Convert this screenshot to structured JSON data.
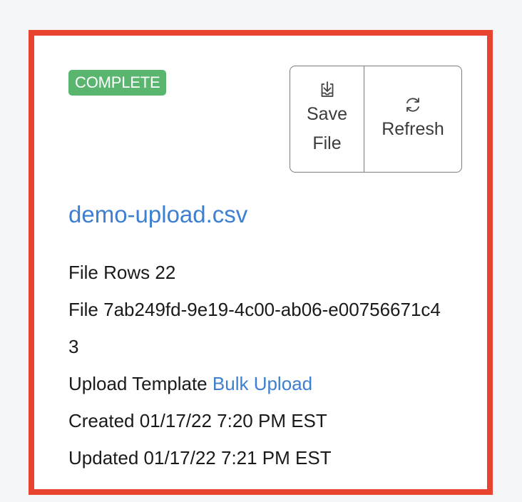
{
  "status": {
    "label": "COMPLETE",
    "color": "#5ab56e"
  },
  "actions": {
    "save_label": "Save File",
    "save_icon": "download-tray-icon",
    "refresh_label": "Refresh",
    "refresh_icon": "refresh-icon"
  },
  "file": {
    "name": "demo-upload.csv",
    "rows_label": "File Rows",
    "rows_value": "22",
    "id_label": "File",
    "id_value": "7ab249fd-9e19-4c00-ab06-e00756671c43",
    "template_label": "Upload Template",
    "template_value": "Bulk Upload",
    "created_label": "Created",
    "created_value": "01/17/22 7:20 PM EST",
    "updated_label": "Updated",
    "updated_value": "01/17/22 7:21 PM EST"
  },
  "colors": {
    "highlight_border": "#e8432f",
    "link": "#3d7fd0"
  }
}
